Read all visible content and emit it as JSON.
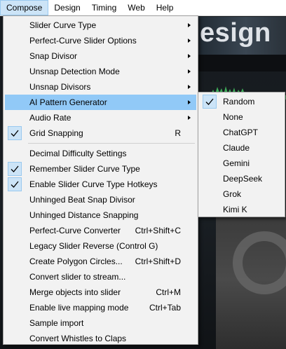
{
  "menubar": {
    "items": [
      "Compose",
      "Design",
      "Timing",
      "Web",
      "Help"
    ]
  },
  "background": {
    "title_fragment": "esign"
  },
  "compose_menu": {
    "items": [
      {
        "label": "Slider Curve Type",
        "submenu": true
      },
      {
        "label": "Perfect-Curve Slider Options",
        "submenu": true
      },
      {
        "label": "Snap Divisor",
        "submenu": true
      },
      {
        "label": "Unsnap Detection Mode",
        "submenu": true
      },
      {
        "label": "Unsnap Divisors",
        "submenu": true
      },
      {
        "label": "AI Pattern Generator",
        "submenu": true,
        "highlighted": true
      },
      {
        "label": "Audio Rate",
        "submenu": true
      },
      {
        "label": "Grid Snapping",
        "shortcut": "R",
        "checked": true
      },
      {
        "label": "Decimal Difficulty Settings"
      },
      {
        "label": "Remember Slider Curve Type",
        "checked": true
      },
      {
        "label": "Enable Slider Curve Type Hotkeys",
        "checked": true
      },
      {
        "label": "Unhinged Beat Snap Divisor"
      },
      {
        "label": "Unhinged Distance Snapping"
      },
      {
        "label": "Perfect-Curve Converter",
        "shortcut": "Ctrl+Shift+C"
      },
      {
        "label": "Legacy Slider Reverse (Control G)"
      },
      {
        "label": "Create Polygon Circles...",
        "shortcut": "Ctrl+Shift+D"
      },
      {
        "label": "Convert slider to stream..."
      },
      {
        "label": "Merge objects into slider",
        "shortcut": "Ctrl+M"
      },
      {
        "label": "Enable live mapping mode",
        "shortcut": "Ctrl+Tab"
      },
      {
        "label": "Sample import"
      },
      {
        "label": "Convert Whistles to Claps"
      }
    ]
  },
  "ai_submenu": {
    "items": [
      {
        "label": "Random",
        "checked": true
      },
      {
        "label": "None"
      },
      {
        "label": "ChatGPT"
      },
      {
        "label": "Claude"
      },
      {
        "label": "Gemini"
      },
      {
        "label": "DeepSeek"
      },
      {
        "label": "Grok"
      },
      {
        "label": "Kimi K"
      }
    ]
  },
  "colors": {
    "highlight": "#91c9f7",
    "check_bg": "#cce4f7",
    "menu_bg": "#f2f2f2"
  }
}
